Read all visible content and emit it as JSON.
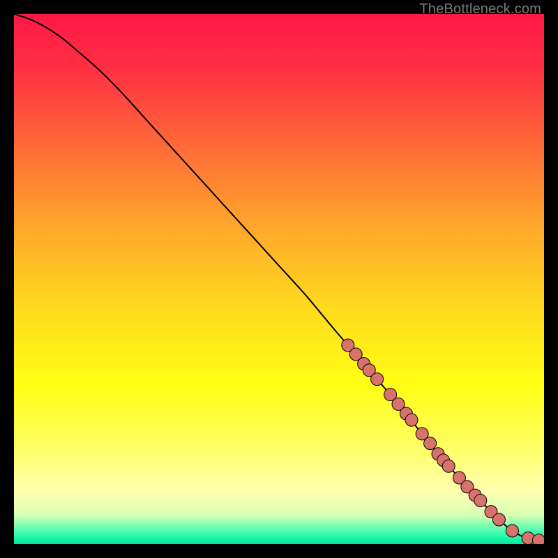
{
  "watermark": "TheBottleneck.com",
  "colors": {
    "bg": "#000000",
    "curve": "#000000",
    "marker_fill": "#d9716d",
    "marker_stroke": "#000000",
    "gradient_stops": [
      {
        "offset": 0.0,
        "color": "#ff1846"
      },
      {
        "offset": 0.1,
        "color": "#ff2f44"
      },
      {
        "offset": 0.25,
        "color": "#ff6a38"
      },
      {
        "offset": 0.4,
        "color": "#ffa62c"
      },
      {
        "offset": 0.55,
        "color": "#ffd91e"
      },
      {
        "offset": 0.7,
        "color": "#ffff14"
      },
      {
        "offset": 0.82,
        "color": "#ffff66"
      },
      {
        "offset": 0.9,
        "color": "#ffffb0"
      },
      {
        "offset": 0.945,
        "color": "#d8ffb4"
      },
      {
        "offset": 0.965,
        "color": "#7bfeb0"
      },
      {
        "offset": 0.985,
        "color": "#26fcab"
      },
      {
        "offset": 1.0,
        "color": "#00e69a"
      }
    ]
  },
  "chart_data": {
    "type": "line",
    "title": "",
    "xlabel": "",
    "ylabel": "",
    "xlim": [
      0,
      100
    ],
    "ylim": [
      0,
      100
    ],
    "grid": false,
    "series": [
      {
        "name": "curve",
        "x": [
          0,
          3,
          6,
          9,
          12,
          16,
          20,
          25,
          30,
          35,
          40,
          45,
          50,
          55,
          60,
          63,
          66,
          69,
          72,
          74,
          76,
          78,
          80,
          82,
          84,
          86,
          88,
          89.5,
          91,
          92.5,
          94,
          96,
          98,
          100
        ],
        "y": [
          100,
          99,
          97.5,
          95.5,
          93,
          89.5,
          85.5,
          80,
          74.5,
          69,
          63.5,
          58,
          52.5,
          47,
          41,
          37.5,
          34,
          30.5,
          27,
          24.5,
          22,
          19.5,
          17,
          14.7,
          12.5,
          10.3,
          8.2,
          6.6,
          5.1,
          3.7,
          2.5,
          1.4,
          0.8,
          0.6
        ]
      }
    ],
    "markers": {
      "name": "highlighted-segment",
      "points": [
        {
          "x": 63.0,
          "y": 37.5
        },
        {
          "x": 64.5,
          "y": 35.8
        },
        {
          "x": 66.0,
          "y": 34.0
        },
        {
          "x": 67.0,
          "y": 32.8
        },
        {
          "x": 68.5,
          "y": 31.1
        },
        {
          "x": 71.0,
          "y": 28.2
        },
        {
          "x": 72.5,
          "y": 26.4
        },
        {
          "x": 74.0,
          "y": 24.6
        },
        {
          "x": 75.0,
          "y": 23.4
        },
        {
          "x": 77.0,
          "y": 20.8
        },
        {
          "x": 78.5,
          "y": 19.0
        },
        {
          "x": 80.0,
          "y": 17.0
        },
        {
          "x": 81.0,
          "y": 15.8
        },
        {
          "x": 82.0,
          "y": 14.7
        },
        {
          "x": 84.0,
          "y": 12.5
        },
        {
          "x": 85.5,
          "y": 10.8
        },
        {
          "x": 87.0,
          "y": 9.2
        },
        {
          "x": 88.0,
          "y": 8.2
        },
        {
          "x": 90.0,
          "y": 6.1
        },
        {
          "x": 91.5,
          "y": 4.6
        },
        {
          "x": 94.0,
          "y": 2.5
        },
        {
          "x": 97.0,
          "y": 1.1
        },
        {
          "x": 99.0,
          "y": 0.7
        }
      ],
      "radius": 9
    }
  }
}
